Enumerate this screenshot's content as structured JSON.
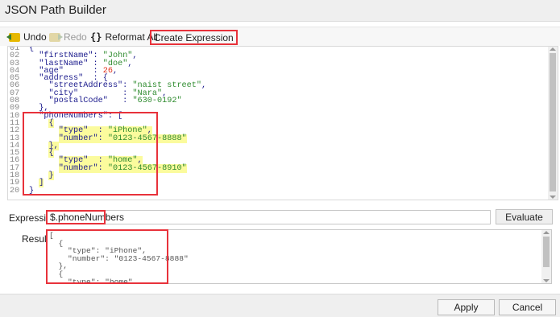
{
  "window": {
    "title": "JSON Path Builder"
  },
  "toolbar": {
    "undo_label": "Undo",
    "redo_label": "Redo",
    "reformat_icon": "{}",
    "reformat_label": "Reformat All",
    "create_label": "Create Expression"
  },
  "editor": {
    "lines": [
      {
        "n": "01",
        "t": "{"
      },
      {
        "n": "02",
        "t": "  \"firstName\": \"John\","
      },
      {
        "n": "03",
        "t": "  \"lastName\" : \"doe\","
      },
      {
        "n": "04",
        "t": "  \"age\"      : 26,"
      },
      {
        "n": "05",
        "t": "  \"address\"  : {"
      },
      {
        "n": "06",
        "t": "    \"streetAddress\": \"naist street\","
      },
      {
        "n": "07",
        "t": "    \"city\"         : \"Nara\","
      },
      {
        "n": "08",
        "t": "    \"postalCode\"   : \"630-0192\""
      },
      {
        "n": "09",
        "t": "  },"
      },
      {
        "n": "10",
        "t": "  \"phoneNumbers\": ["
      },
      {
        "n": "11",
        "t": "    {"
      },
      {
        "n": "12",
        "t": "      \"type\"  : \"iPhone\","
      },
      {
        "n": "13",
        "t": "      \"number\": \"0123-4567-8888\""
      },
      {
        "n": "14",
        "t": "    },"
      },
      {
        "n": "15",
        "t": "    {"
      },
      {
        "n": "16",
        "t": "      \"type\"  : \"home\","
      },
      {
        "n": "17",
        "t": "      \"number\": \"0123-4567-8910\""
      },
      {
        "n": "18",
        "t": "    }"
      },
      {
        "n": "19",
        "t": "  ]"
      },
      {
        "n": "20",
        "t": "}"
      }
    ]
  },
  "expression": {
    "label": "Expression",
    "value": "$.phoneNumbers",
    "evaluate_label": "Evaluate"
  },
  "result": {
    "label": "Result",
    "lines": [
      "[",
      "  {",
      "    \"type\": \"iPhone\",",
      "    \"number\": \"0123-4567-8888\"",
      "  },",
      "  {",
      "    \"type\": \"home\","
    ]
  },
  "footer": {
    "apply_label": "Apply",
    "cancel_label": "Cancel"
  },
  "colors": {
    "highlight_border": "#e8323b",
    "selection": "#fbfb9d",
    "string": "#2e8b2e",
    "number": "#e0321c",
    "key": "#1a1a8c"
  }
}
